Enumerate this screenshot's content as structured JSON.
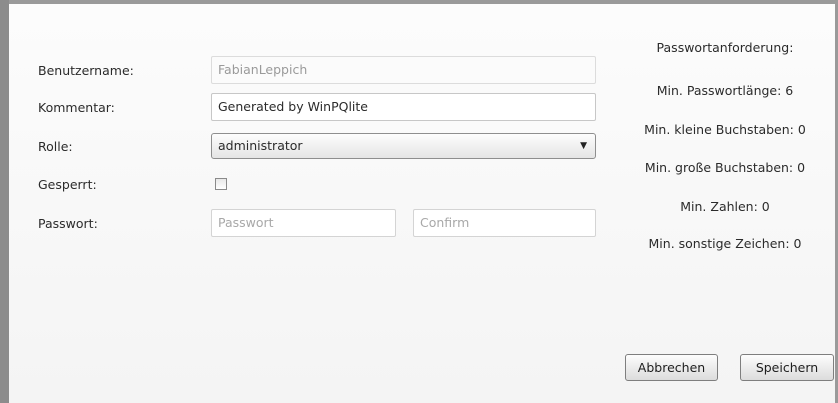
{
  "form": {
    "username_label": "Benutzername:",
    "username_value": "FabianLeppich",
    "comment_label": "Kommentar:",
    "comment_value": "Generated by WinPQlite",
    "role_label": "Rolle:",
    "role_value": "administrator",
    "locked_label": "Gesperrt:",
    "locked_checked": false,
    "password_label": "Passwort:",
    "password_placeholder": "Passwort",
    "confirm_placeholder": "Confirm"
  },
  "requirements": {
    "title": "Passwortanforderung:",
    "min_length": "Min. Passwortlänge: 6",
    "min_lowercase": "Min. kleine Buchstaben: 0",
    "min_uppercase": "Min. große Buchstaben: 0",
    "min_digits": "Min. Zahlen: 0",
    "min_other": "Min. sonstige Zeichen: 0"
  },
  "buttons": {
    "cancel": "Abbrechen",
    "save": "Speichern"
  }
}
